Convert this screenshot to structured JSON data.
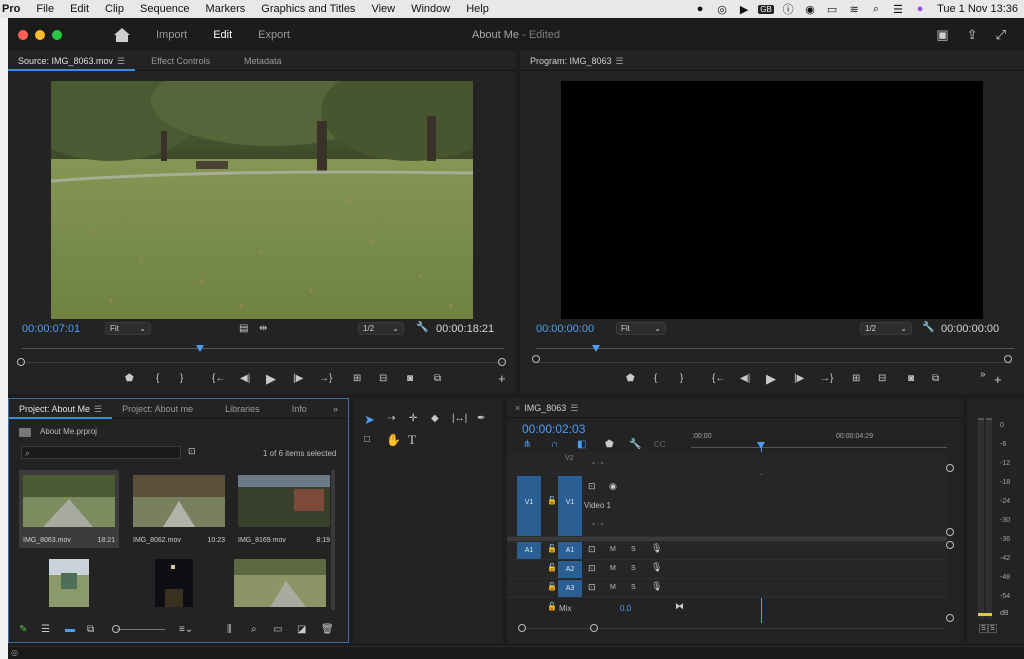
{
  "menubar": {
    "app": "Pro",
    "items": [
      "File",
      "Edit",
      "Clip",
      "Sequence",
      "Markers",
      "Graphics and Titles",
      "View",
      "Window",
      "Help"
    ],
    "status_icons": [
      "creative-cloud-icon",
      "sync-icon",
      "play-circle-icon",
      "keyboard-layout-icon",
      "info-circle-icon",
      "shazam-icon",
      "battery-icon",
      "wifi-icon",
      "search-icon",
      "control-center-icon",
      "siri-icon"
    ],
    "keyboard_layout": "GB",
    "clock": "Tue 1 Nov  13:36"
  },
  "titlebar": {
    "workspaces": [
      "Import",
      "Edit",
      "Export"
    ],
    "active_workspace": "Edit",
    "doc_title": "About Me",
    "doc_status": " - Edited",
    "colors": {
      "close": "#ff5f57",
      "minimize": "#febc2e",
      "zoom": "#28c840"
    }
  },
  "source_monitor": {
    "tabs": [
      "Source: IMG_8063.mov",
      "Effect Controls",
      "Metadata"
    ],
    "timecode_in": "00:00:07:01",
    "fit": "Fit",
    "resolution": "1/2",
    "duration": "00:00:18:21"
  },
  "program_monitor": {
    "tab": "Program: IMG_8063",
    "timecode": "00:00:00:00",
    "fit": "Fit",
    "resolution": "1/2",
    "duration": "00:00:00:00"
  },
  "project": {
    "tabs": [
      "Project: About Me",
      "Project: About me",
      "Libraries",
      "Info"
    ],
    "file": "About Me.prproj",
    "selection_info": "1 of 6 items selected",
    "items": [
      {
        "name": "IMG_8063.mov",
        "duration": "18:21"
      },
      {
        "name": "IMG_8062.mov",
        "duration": "10:23"
      },
      {
        "name": "IMG_8169.mov",
        "duration": "8:19"
      },
      {
        "name": "",
        "duration": ""
      },
      {
        "name": "",
        "duration": ""
      },
      {
        "name": "",
        "duration": ""
      }
    ]
  },
  "timeline": {
    "tab": "IMG_8063",
    "timecode": "00:00:02:03",
    "ruler_start": ":00:00",
    "ruler_mid": "00:00:04:29",
    "tracks": {
      "v2": "V2",
      "v1": "V1",
      "v1_name": "Video 1",
      "a1": "A1",
      "a2": "A2",
      "a3": "A3",
      "mix": "Mix",
      "mix_value": "0.0",
      "m": "M",
      "s": "S"
    }
  },
  "meter": {
    "labels": [
      "0",
      "-6",
      "-12",
      "-18",
      "-24",
      "-30",
      "-36",
      "-42",
      "-48",
      "-54",
      "dB"
    ],
    "solo": [
      "S",
      "S"
    ]
  }
}
